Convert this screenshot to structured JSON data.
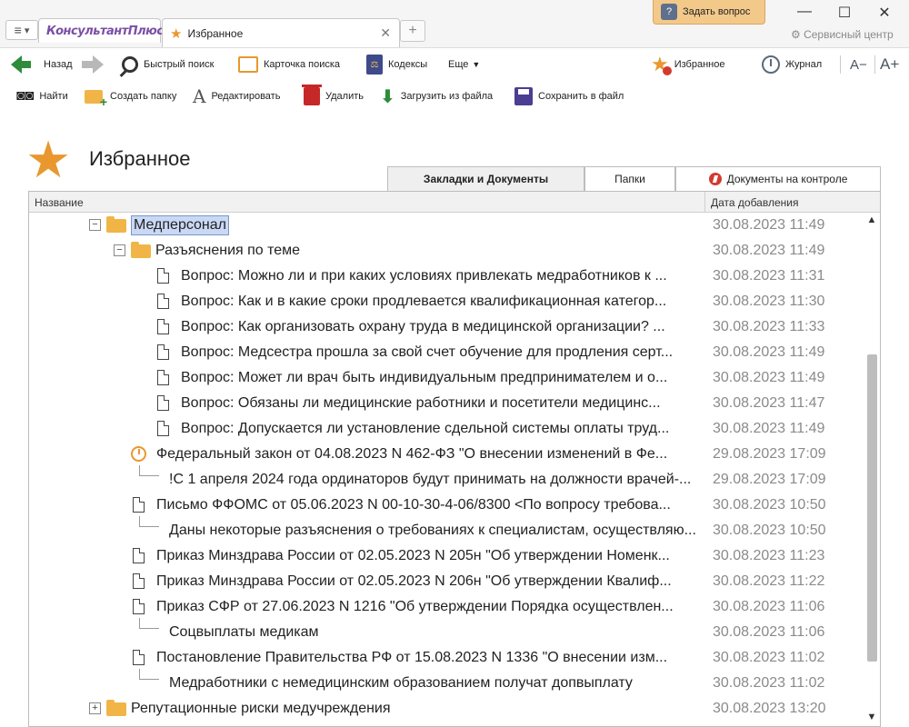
{
  "window": {
    "menu_label": "▾",
    "app_tab_logo": "КонсультантПлюс",
    "active_tab_title": "Избранное",
    "close_glyph": "✕",
    "new_tab_glyph": "+",
    "ask_button": "Задать вопрос",
    "service_center": "Сервисный центр",
    "controls": {
      "minimize": "—",
      "maximize": "☐",
      "close": "✕"
    }
  },
  "nav": {
    "back": "Назад",
    "quick_search": "Быстрый поиск",
    "search_card": "Карточка поиска",
    "codexes": "Кодексы",
    "codex_glyph": "⚖",
    "more": "Еще",
    "favorites": "Избранное",
    "journal": "Журнал",
    "zoom_out": "A−",
    "zoom_in": "A+"
  },
  "actions": {
    "find": "Найти",
    "create_folder": "Создать папку",
    "edit": "Редактировать",
    "delete": "Удалить",
    "upload": "Загрузить из файла",
    "save": "Сохранить в файл"
  },
  "page": {
    "title": "Избранное"
  },
  "content_tabs": [
    {
      "label": "Закладки и Документы",
      "active": true
    },
    {
      "label": "Папки",
      "active": false
    },
    {
      "label": "Документы на контроле",
      "active": false
    }
  ],
  "columns": {
    "name": "Название",
    "date": "Дата добавления"
  },
  "rows": [
    {
      "kind": "folder",
      "expander": "−",
      "level": 0,
      "selected": true,
      "title": "Медперсонал",
      "date": "30.08.2023 11:49"
    },
    {
      "kind": "folder",
      "expander": "−",
      "level": 1,
      "title": "Разъяснения по теме",
      "date": "30.08.2023 11:49"
    },
    {
      "kind": "doc",
      "level": 2,
      "title": "Вопрос: Можно ли и при каких условиях привлекать медработников к ...",
      "date": "30.08.2023 11:31"
    },
    {
      "kind": "doc",
      "level": 2,
      "title": "Вопрос: Как и в какие сроки продлевается квалификационная категор...",
      "date": "30.08.2023 11:30"
    },
    {
      "kind": "doc",
      "level": 2,
      "title": "Вопрос: Как организовать охрану труда в медицинской организации? ...",
      "date": "30.08.2023 11:33"
    },
    {
      "kind": "doc",
      "level": 2,
      "title": "Вопрос: Медсестра прошла за свой счет обучение для продления серт...",
      "date": "30.08.2023 11:49"
    },
    {
      "kind": "doc",
      "level": 2,
      "title": "Вопрос: Может ли врач быть индивидуальным предпринимателем и о...",
      "date": "30.08.2023 11:49"
    },
    {
      "kind": "doc",
      "level": 2,
      "title": "Вопрос: Обязаны ли медицинские работники и посетители медицинс...",
      "date": "30.08.2023 11:47"
    },
    {
      "kind": "doc",
      "level": 2,
      "title": "Вопрос: Допускается ли установление сдельной системы оплаты труд...",
      "date": "30.08.2023 11:49"
    },
    {
      "kind": "timer",
      "level": 1,
      "title": "Федеральный закон от 04.08.2023 N 462-ФЗ \"О внесении изменений в Фе...",
      "date": "29.08.2023 17:09"
    },
    {
      "kind": "bookmark",
      "level": 1,
      "title": "!С 1 апреля 2024 года ординаторов будут принимать на должности врачей-...",
      "date": "29.08.2023 17:09"
    },
    {
      "kind": "doc",
      "level": 1,
      "title": "Письмо ФФОМС от 05.06.2023 N 00-10-30-4-06/8300 <По вопросу требова...",
      "date": "30.08.2023 10:50"
    },
    {
      "kind": "bookmark",
      "level": 1,
      "title": "Даны некоторые разъяснения о требованиях к специалистам, осуществляю...",
      "date": "30.08.2023 10:50"
    },
    {
      "kind": "doc",
      "level": 1,
      "title": "Приказ Минздрава России от 02.05.2023 N 205н \"Об утверждении Номенк...",
      "date": "30.08.2023 11:23"
    },
    {
      "kind": "doc",
      "level": 1,
      "title": "Приказ Минздрава России от 02.05.2023 N 206н \"Об утверждении Квалиф...",
      "date": "30.08.2023 11:22"
    },
    {
      "kind": "doc",
      "level": 1,
      "title": "Приказ СФР от 27.06.2023 N 1216 \"Об утверждении Порядка осуществлен...",
      "date": "30.08.2023 11:06"
    },
    {
      "kind": "bookmark",
      "level": 1,
      "title": "Соцвыплаты медикам",
      "date": "30.08.2023 11:06"
    },
    {
      "kind": "doc",
      "level": 1,
      "title": "Постановление Правительства РФ от 15.08.2023 N 1336 \"О внесении изм...",
      "date": "30.08.2023 11:02"
    },
    {
      "kind": "bookmark",
      "level": 1,
      "title": "Медработники с немедицинским образованием получат допвыплату",
      "date": "30.08.2023 11:02"
    },
    {
      "kind": "folder",
      "expander": "+",
      "level": 0,
      "title": "Репутационные риски медучреждения",
      "date": "30.08.2023 13:20"
    }
  ],
  "scrollbar": {
    "up": "▲",
    "down": "▼"
  }
}
